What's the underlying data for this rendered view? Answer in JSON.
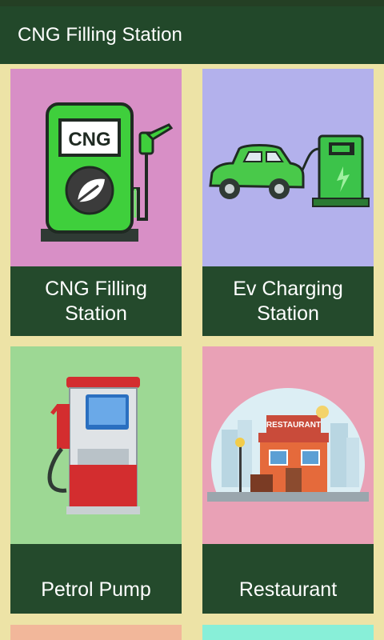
{
  "app": {
    "title": "CNG Filling Station"
  },
  "colors": {
    "appbar": "#22482a",
    "background": "#ede3a6",
    "label_bg": "#244a2c",
    "card_cng": "#d88fc6",
    "card_ev": "#b3b1ec",
    "card_petrol": "#9dd894",
    "card_restaurant": "#e9a1b6",
    "card_5": "#f2b79a",
    "card_6": "#88efd8"
  },
  "cards": [
    {
      "label": "CNG Filling\nStation",
      "icon": "cng-pump-icon",
      "badge": "CNG"
    },
    {
      "label": "Ev Charging\nStation",
      "icon": "ev-charger-icon"
    },
    {
      "label": "Petrol Pump",
      "icon": "petrol-pump-icon"
    },
    {
      "label": "Restaurant",
      "icon": "restaurant-icon",
      "sign": "RESTAURANT"
    }
  ]
}
